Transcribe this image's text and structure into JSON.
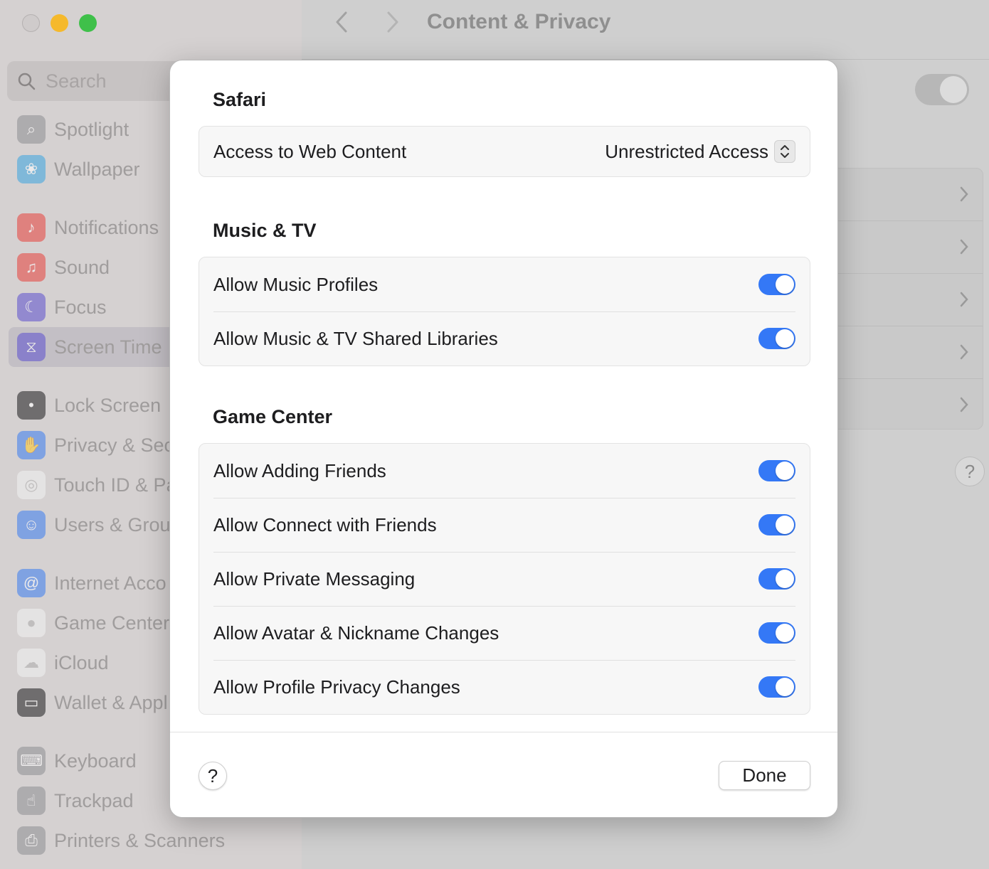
{
  "window": {
    "title": "Content & Privacy",
    "search_placeholder": "Search"
  },
  "sidebar": {
    "items": [
      {
        "label": "Spotlight",
        "icon": "spotlight-icon",
        "color": "#8e8e93"
      },
      {
        "label": "Wallpaper",
        "icon": "wallpaper-icon",
        "color": "#3aa4e0"
      },
      {
        "label": "Notifications",
        "icon": "notifications-icon",
        "color": "#e8413c"
      },
      {
        "label": "Sound",
        "icon": "sound-icon",
        "color": "#e8413c"
      },
      {
        "label": "Focus",
        "icon": "focus-icon",
        "color": "#5d4fcf"
      },
      {
        "label": "Screen Time",
        "icon": "screen-time-icon",
        "color": "#5d4fcf",
        "selected": true
      },
      {
        "label": "Lock Screen",
        "icon": "lock-icon",
        "color": "#1d1d1f"
      },
      {
        "label": "Privacy & Sec",
        "icon": "hand-icon",
        "color": "#3a7cf0"
      },
      {
        "label": "Touch ID & Pa",
        "icon": "fingerprint-icon",
        "color": "#f2f2f2"
      },
      {
        "label": "Users & Grou",
        "icon": "users-icon",
        "color": "#3a7cf0"
      },
      {
        "label": "Internet Acco",
        "icon": "at-icon",
        "color": "#3a7cf0"
      },
      {
        "label": "Game Center",
        "icon": "game-center-icon",
        "color": "#f2f2f2"
      },
      {
        "label": "iCloud",
        "icon": "cloud-icon",
        "color": "#f2f2f2"
      },
      {
        "label": "Wallet & Appl",
        "icon": "wallet-icon",
        "color": "#1d1d1f"
      },
      {
        "label": "Keyboard",
        "icon": "keyboard-icon",
        "color": "#8e8e93"
      },
      {
        "label": "Trackpad",
        "icon": "trackpad-icon",
        "color": "#8e8e93"
      },
      {
        "label": "Printers & Scanners",
        "icon": "printer-icon",
        "color": "#8e8e93"
      }
    ]
  },
  "sheet": {
    "safari": {
      "title": "Safari",
      "web_content_label": "Access to Web Content",
      "web_content_value": "Unrestricted Access"
    },
    "music_tv": {
      "title": "Music & TV",
      "rows": [
        {
          "label": "Allow Music Profiles",
          "on": true
        },
        {
          "label": "Allow Music & TV Shared Libraries",
          "on": true
        }
      ]
    },
    "game_center": {
      "title": "Game Center",
      "rows": [
        {
          "label": "Allow Adding Friends",
          "on": true
        },
        {
          "label": "Allow Connect with Friends",
          "on": true
        },
        {
          "label": "Allow Private Messaging",
          "on": true
        },
        {
          "label": "Allow Avatar & Nickname Changes",
          "on": true
        },
        {
          "label": "Allow Profile Privacy Changes",
          "on": true
        }
      ]
    },
    "help_label": "?",
    "done_label": "Done"
  },
  "colors": {
    "toggle_on": "#3478f6",
    "sheet_bg": "#ffffff"
  }
}
